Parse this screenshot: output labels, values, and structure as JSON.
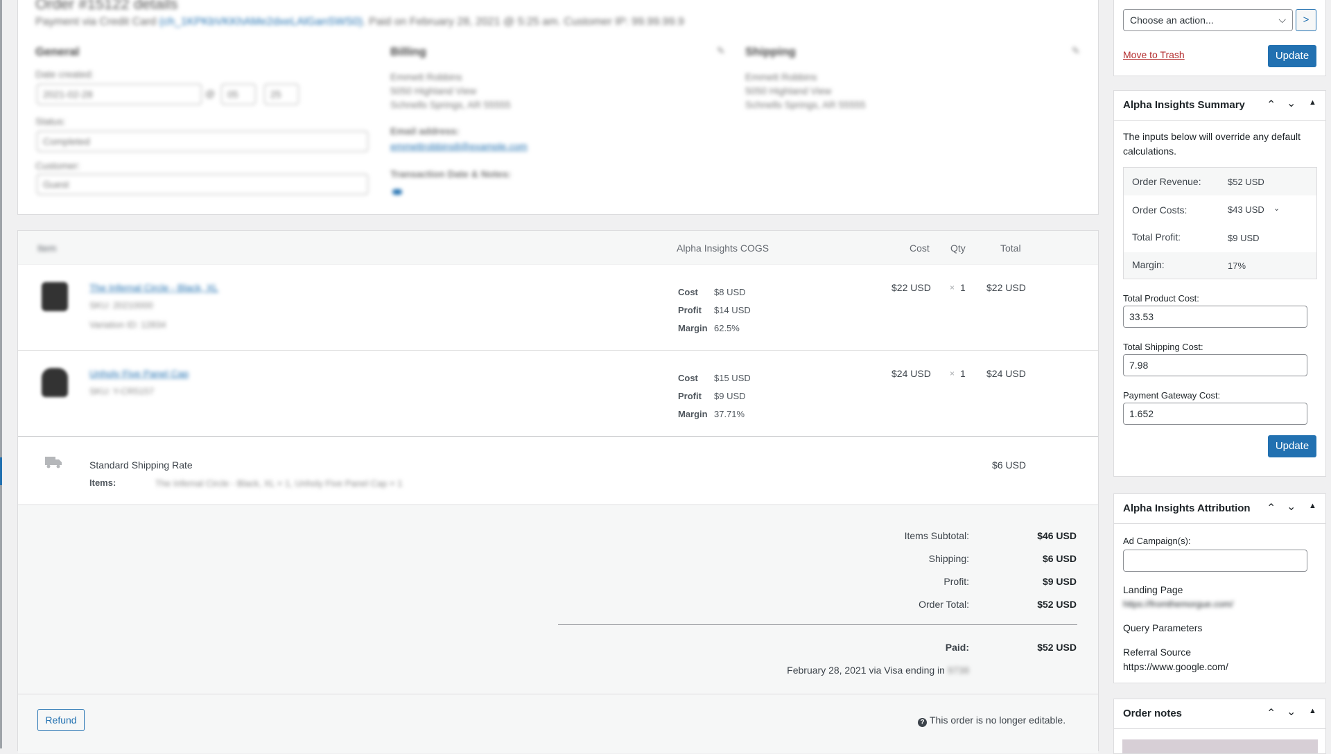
{
  "order": {
    "title": "Order #15122 details",
    "subtitle_prefix": "Payment via Credit Card",
    "subtitle_link": "(ch_1KPKbVKKhAMe2dxeLAlGanSWS0)",
    "subtitle_rest": ". Paid on February 28, 2021 @ 5:25 am. Customer IP: 99.99.99.9",
    "general_heading": "General",
    "billing_heading": "Billing",
    "shipping_heading": "Shipping",
    "date_created_label": "Date created:",
    "date_value": "2021-02-28",
    "hour_value": "05",
    "minute_value": "25",
    "status_label": "Status:",
    "status_value": "Completed",
    "customer_label": "Customer:",
    "customer_value": "Guest",
    "billing_lines": [
      "Emmett Robbins",
      "5050 Highland View",
      "Schnells Springs, AR 55555"
    ],
    "email_label": "Email address:",
    "email_value": "emmettrobbins8@example.com",
    "transaction_label": "Transaction Date & Notes:",
    "shipping_lines": [
      "Emmett Robbins",
      "5050 Highland View",
      "Schnells Springs, AR 55555"
    ]
  },
  "items_table": {
    "headers": {
      "item": "Item",
      "cogs": "Alpha Insights COGS",
      "cost": "Cost",
      "qty": "Qty",
      "total": "Total"
    },
    "rows": [
      {
        "name": "The Infernal Circle - Black, XL",
        "sku": "SKU: 20210000",
        "variation": "Variation ID: 12834",
        "cogs_cost_label": "Cost",
        "cogs_cost": "$8 USD",
        "cogs_profit_label": "Profit",
        "cogs_profit": "$14 USD",
        "cogs_margin_label": "Margin",
        "cogs_margin": "62.5%",
        "cost": "$22 USD",
        "qty_x": "×",
        "qty": "1",
        "total": "$22 USD"
      },
      {
        "name": "Unholy Five Panel Cap",
        "sku": "SKU: Y-CR5157",
        "variation": "",
        "cogs_cost_label": "Cost",
        "cogs_cost": "$15 USD",
        "cogs_profit_label": "Profit",
        "cogs_profit": "$9 USD",
        "cogs_margin_label": "Margin",
        "cogs_margin": "37.71%",
        "cost": "$24 USD",
        "qty_x": "×",
        "qty": "1",
        "total": "$24 USD"
      }
    ],
    "shipping": {
      "name": "Standard Shipping Rate",
      "items_label": "Items:",
      "items_value": "The Infernal Circle - Black, XL × 1, Unholy Five Panel Cap × 1",
      "total": "$6 USD"
    },
    "totals": [
      {
        "label": "Items Subtotal:",
        "value": "$46 USD"
      },
      {
        "label": "Shipping:",
        "value": "$6 USD"
      },
      {
        "label": "Profit:",
        "value": "$9 USD"
      },
      {
        "label": "Order Total:",
        "value": "$52 USD"
      }
    ],
    "paid_label": "Paid:",
    "paid_value": "$52 USD",
    "paid_note": "February 28, 2021 via Visa ending in",
    "paid_card": "9738",
    "refund_label": "Refund",
    "not_editable": "This order is no longer editable."
  },
  "actions": {
    "select_value": "Choose an action...",
    "go_label": ">",
    "trash_label": "Move to Trash",
    "update_label": "Update"
  },
  "summary": {
    "title": "Alpha Insights Summary",
    "intro": "The inputs below will override any default calculations.",
    "rows": [
      {
        "label": "Order Revenue:",
        "value": "$52 USD"
      },
      {
        "label": "Order Costs:",
        "value": "$43 USD"
      },
      {
        "label": "Total Profit:",
        "value": "$9 USD"
      },
      {
        "label": "Margin:",
        "value": "17%"
      }
    ],
    "product_cost_label": "Total Product Cost:",
    "product_cost_value": "33.53",
    "shipping_cost_label": "Total Shipping Cost:",
    "shipping_cost_value": "7.98",
    "gateway_cost_label": "Payment Gateway Cost:",
    "gateway_cost_value": "1.652",
    "update_label": "Update"
  },
  "attribution": {
    "title": "Alpha Insights Attribution",
    "campaign_label": "Ad Campaign(s):",
    "campaign_value": "",
    "landing_label": "Landing Page",
    "landing_value": "https://fromthemorgue.com/",
    "query_label": "Query Parameters",
    "referral_label": "Referral Source",
    "referral_value": "https://www.google.com/"
  },
  "notes": {
    "title": "Order notes"
  },
  "icons": {
    "up": "chevron-up-icon",
    "down": "chevron-down-icon",
    "toggle": "caret-up-icon",
    "help": "help-icon",
    "truck": "truck-icon"
  },
  "colors": {
    "accent": "#2271b1",
    "trash": "#b32d2e",
    "panel_bg": "#ffffff",
    "page_bg": "#f0f0f1"
  }
}
